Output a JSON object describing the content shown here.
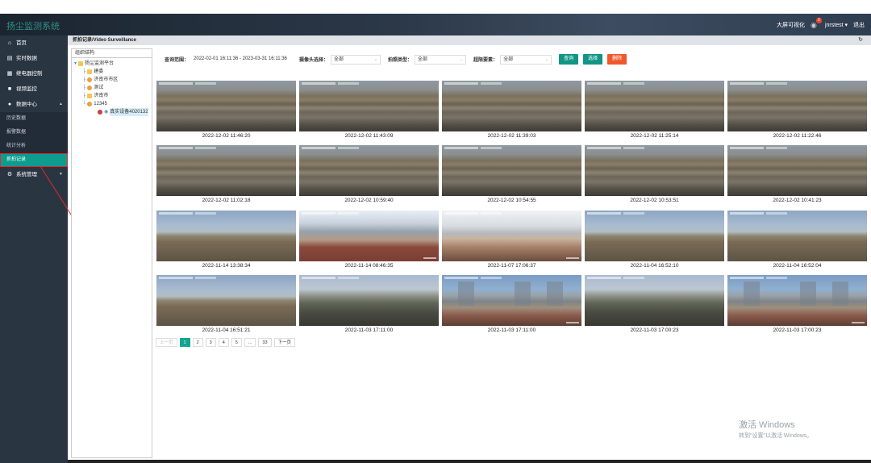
{
  "header": {
    "app_title": "扬尘监测系统",
    "big_screen_label": "大屏可视化",
    "notification_count": "2",
    "username": "jnrstest",
    "logout_label": "退出"
  },
  "sidebar": {
    "items": [
      {
        "label": "首页",
        "icon": "home-icon"
      },
      {
        "label": "实时数据",
        "icon": "chart-icon"
      },
      {
        "label": "继电器控制",
        "icon": "relay-icon"
      },
      {
        "label": "视频监控",
        "icon": "video-icon"
      },
      {
        "label": "数据中心",
        "icon": "data-icon"
      }
    ],
    "sub_items": [
      {
        "label": "历史数据"
      },
      {
        "label": "报警数据"
      },
      {
        "label": "统计分析"
      },
      {
        "label": "抓拍记录"
      }
    ],
    "system_label": "系统管理"
  },
  "breadcrumb": {
    "text": "抓拍记录/Video Surveillance"
  },
  "tree": {
    "title": "组织结构",
    "nodes": [
      {
        "label": "扬尘监测平台"
      },
      {
        "label": "建委"
      },
      {
        "label": "济南市市区"
      },
      {
        "label": "测试"
      },
      {
        "label": "济南市"
      },
      {
        "label": "12345"
      },
      {
        "label": "真实设备4020132"
      }
    ]
  },
  "toolbar": {
    "date_label": "查询范围：",
    "date_value": "2022-02-01 16:11:36 - 2023-03-31 16:11:36",
    "camera_label": "摄像头选择：",
    "camera_value": "全部",
    "type_label": "拍照类型：",
    "type_value": "全部",
    "exceed_label": "超限要素：",
    "exceed_value": "全部",
    "query_label": "查询",
    "select_label": "选择",
    "delete_label": "删除"
  },
  "photos": [
    {
      "time": "2022-12-02 11:46:20",
      "scene": "mtn"
    },
    {
      "time": "2022-12-02 11:43:09",
      "scene": "mtn"
    },
    {
      "time": "2022-12-02 11:39:03",
      "scene": "mtn"
    },
    {
      "time": "2022-12-02 11:25:14",
      "scene": "mtn"
    },
    {
      "time": "2022-12-02 11:22:46",
      "scene": "mtn"
    },
    {
      "time": "2022-12-02 11:02:18",
      "scene": "mtn"
    },
    {
      "time": "2022-12-02 10:59:40",
      "scene": "mtn"
    },
    {
      "time": "2022-12-02 10:54:55",
      "scene": "mtn"
    },
    {
      "time": "2022-12-02 10:53:51",
      "scene": "mtn"
    },
    {
      "time": "2022-12-02 10:41:23",
      "scene": "mtn"
    },
    {
      "time": "2022-11-14 13:38:34",
      "scene": "field"
    },
    {
      "time": "2022-11-14 08:46:35",
      "scene": "roof"
    },
    {
      "time": "2022-11-07 17:06:37",
      "scene": "wall"
    },
    {
      "time": "2022-11-04 16:52:10",
      "scene": "field"
    },
    {
      "time": "2022-11-04 16:52:04",
      "scene": "field"
    },
    {
      "time": "2022-11-04 16:51:21",
      "scene": "field"
    },
    {
      "time": "2022-11-03 17:11:00",
      "scene": "eve"
    },
    {
      "time": "2022-11-03 17:11:00",
      "scene": "bld"
    },
    {
      "time": "2022-11-03 17:00:23",
      "scene": "eve"
    },
    {
      "time": "2022-11-03 17:00:23",
      "scene": "bld"
    }
  ],
  "pager": {
    "prev_label": "上一页",
    "pages": [
      "1",
      "2",
      "3",
      "4",
      "5",
      "...",
      "33"
    ],
    "next_label": "下一页"
  },
  "watermark": {
    "title": "激活 Windows",
    "subtitle": "转到\"设置\"以激活 Windows。"
  },
  "colors": {
    "accent": "#119584",
    "danger": "#f0582b",
    "sidebar": "#2a3542",
    "active_outline": "#e02a2a"
  }
}
